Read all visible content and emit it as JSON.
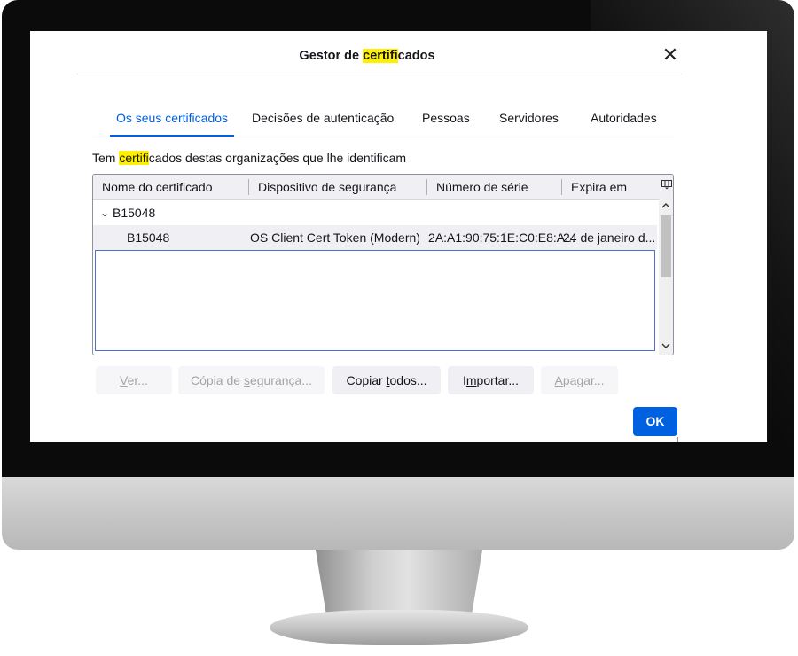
{
  "dialog": {
    "title_prefix": "Gestor de ",
    "title_highlight": "certifi",
    "title_suffix": "cados",
    "close_glyph": "✕"
  },
  "tabs": [
    {
      "label": "Os seus certificados",
      "active": true
    },
    {
      "label": "Decisões de autenticação",
      "active": false
    },
    {
      "label": "Pessoas",
      "active": false
    },
    {
      "label": "Servidores",
      "active": false
    },
    {
      "label": "Autoridades",
      "active": false
    }
  ],
  "intro": {
    "prefix": "Tem ",
    "highlight": "certifi",
    "suffix": "cados destas organizações que lhe identificam"
  },
  "tree": {
    "columns": [
      "Nome do certificado",
      "Dispositivo de segurança",
      "Número de série",
      "Expira em"
    ],
    "column_picker_icon": "column-picker-icon",
    "group": {
      "expander": "⌄",
      "name": "B15048"
    },
    "rows": [
      {
        "name": "B15048",
        "device": "OS Client Cert Token (Modern)",
        "serial": "2A:A1:90:75:1E:C0:E8:A...",
        "expires": "24 de janeiro d..."
      }
    ]
  },
  "buttons": {
    "view": {
      "pre": "",
      "mnemonic": "V",
      "post": "er..."
    },
    "backup": {
      "pre": "Cópia de ",
      "mnemonic": "s",
      "post": "egurança..."
    },
    "backup_all": {
      "pre": "Copiar ",
      "mnemonic": "t",
      "post": "odos..."
    },
    "import": {
      "pre": "I",
      "mnemonic": "m",
      "post": "portar..."
    },
    "delete": {
      "pre": "",
      "mnemonic": "A",
      "post": "pagar..."
    },
    "ok": "OK"
  },
  "colors": {
    "accent": "#0061e0",
    "highlight": "#fff000",
    "bezel": "#0b0b0b"
  }
}
